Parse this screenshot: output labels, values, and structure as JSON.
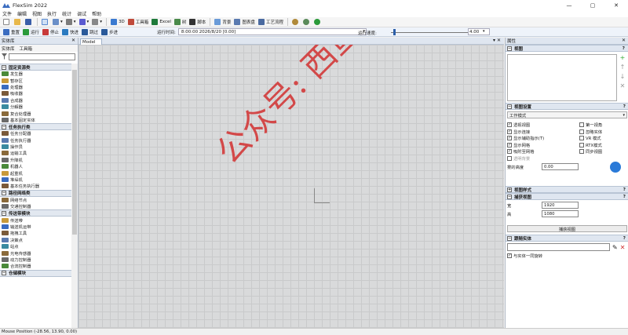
{
  "window": {
    "title": "FlexSim 2022",
    "controls": [
      "—",
      "▢",
      "✕"
    ]
  },
  "menu": [
    "文件",
    "编辑",
    "视图",
    "执行",
    "统计",
    "调试",
    "帮助"
  ],
  "toolbar1": {
    "btn_3d": "3D",
    "btn_toolbox": "工具箱",
    "btn_excel": "Excel",
    "btn_tree": "树",
    "btn_script": "脚本",
    "btn_background": "背景",
    "btn_dashboard": "图表盘",
    "btn_process": "工艺流程"
  },
  "toolbar2": {
    "reset": "重置",
    "run": "运行",
    "stop": "停止",
    "fast": "快进",
    "skip": "跳过",
    "step": "步进",
    "runtime_label": "运行时间:",
    "runtime_value": "8:00:00  2026/8/20  [0.00]",
    "speed_label": "运行速度:",
    "speed_value": "4.00",
    "speed_fraction": 0.03
  },
  "library": {
    "title": "实体库",
    "tabs": [
      "实体库",
      "工具箱"
    ],
    "sections": [
      {
        "name": "固定资源类",
        "items": [
          "发生器",
          "暂存区",
          "处理器",
          "吸收器",
          "合成器",
          "分解器",
          "复合处理器",
          "基本固定实体"
        ]
      },
      {
        "name": "任务执行类",
        "items": [
          "任务分配器",
          "任务执行器",
          "操作员",
          "运输工具",
          "升降机",
          "机器人",
          "起重机",
          "堆垛机",
          "基本任务执行器"
        ]
      },
      {
        "name": "路径网络类",
        "items": [
          "网络节点",
          "交通控制器"
        ]
      },
      {
        "name": "传送带模块",
        "items": [
          "传送带",
          "输送机运带",
          "拖拽工具",
          "决策点",
          "站点",
          "光电传感器",
          "动力控制器",
          "合流控制器"
        ]
      },
      {
        "name": "仓储模块",
        "items": []
      }
    ]
  },
  "model": {
    "tab": "Model",
    "watermark": "公众号: 西鱼出没"
  },
  "properties": {
    "title": "属性",
    "sec_views": "视图",
    "sec_view_settings": "视图设置",
    "work_mode": "工作模式",
    "checks_left": [
      {
        "label": "透视视图",
        "checked": true,
        "disabled": false
      },
      {
        "label": "显示连接",
        "checked": true,
        "disabled": false
      },
      {
        "label": "显示辅助指示(T)",
        "checked": true,
        "disabled": false
      },
      {
        "label": "显示网格",
        "checked": true,
        "disabled": false
      },
      {
        "label": "吸附至网格",
        "checked": true,
        "disabled": false
      },
      {
        "label": "透明背景",
        "checked": false,
        "disabled": true
      }
    ],
    "checks_right": [
      {
        "label": "第一视角",
        "checked": false
      },
      {
        "label": "忽略实体",
        "checked": false
      },
      {
        "label": "VR 模式",
        "checked": false
      },
      {
        "label": "RTX模式",
        "checked": false
      },
      {
        "label": "同步视图",
        "checked": false
      }
    ],
    "fog_label": "雾的高度",
    "fog_value": "0.00",
    "sec_view_style": "视图样式",
    "sec_capture": "捕获视图",
    "width_label": "宽",
    "width_value": "1920",
    "height_label": "高",
    "height_value": "1080",
    "capture_button": "捕获视图",
    "sec_follow": "跟随实体",
    "follow_check": "与实体一同旋转"
  },
  "status": "Mouse Position (-28.56, 13.90, 0.00)"
}
